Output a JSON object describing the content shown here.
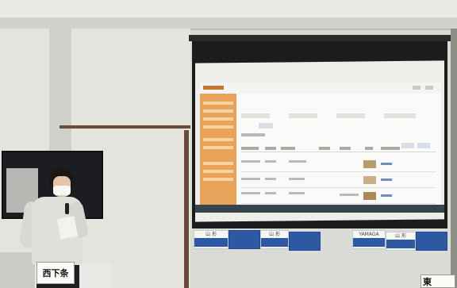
{
  "scene": {
    "description_kind": "photo",
    "name_plates": {
      "left": "西下条",
      "right": "東"
    },
    "banners": [
      {
        "top": "山 形",
        "variant": "white"
      },
      {
        "top": "",
        "variant": "blue"
      },
      {
        "top": "山 形",
        "variant": "white"
      },
      {
        "top": "",
        "variant": "blue"
      },
      {
        "top": "YAMAGA",
        "variant": "white"
      },
      {
        "top": "山 形",
        "variant": "white"
      },
      {
        "top": "",
        "variant": "blue"
      }
    ]
  },
  "colors": {
    "app_sidebar": "#e7a35a",
    "banner_blue": "#2e57a4",
    "taskbar": "#39434e"
  }
}
